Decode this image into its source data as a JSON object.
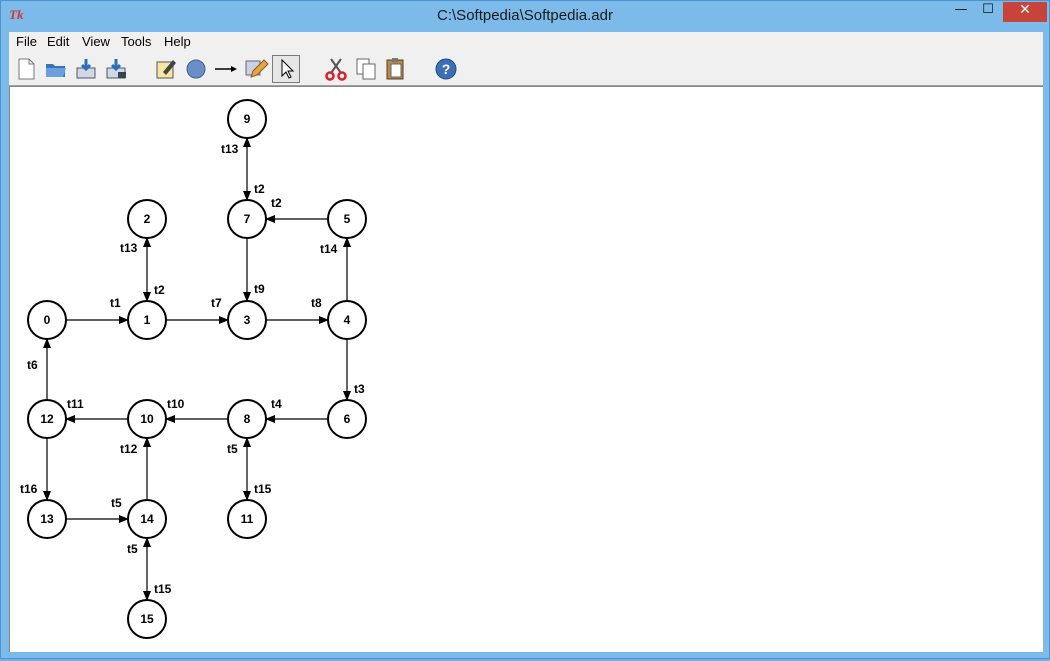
{
  "window": {
    "title": "C:\\Softpedia\\Softpedia.adr",
    "icon_text": "Tk",
    "minimize_glyph": "—",
    "maximize_glyph": "☐",
    "close_glyph": "✕"
  },
  "menu": [
    "File",
    "Edit",
    "View",
    "Tools",
    "Help"
  ],
  "toolbar": [
    "new-file-icon",
    "open-folder-icon",
    "save-icon",
    "save-as-icon",
    "edit-note-icon",
    "place-node-icon",
    "draw-arrow-icon",
    "edit-pencil-icon",
    "select-pointer-icon",
    "cut-scissors-icon",
    "copy-icon",
    "paste-clipboard-icon",
    "help-icon"
  ],
  "graph": {
    "nodes": [
      {
        "id": "0",
        "label": "0"
      },
      {
        "id": "1",
        "label": "1"
      },
      {
        "id": "2",
        "label": "2"
      },
      {
        "id": "3",
        "label": "3"
      },
      {
        "id": "4",
        "label": "4"
      },
      {
        "id": "5",
        "label": "5"
      },
      {
        "id": "6",
        "label": "6"
      },
      {
        "id": "7",
        "label": "7"
      },
      {
        "id": "8",
        "label": "8"
      },
      {
        "id": "9",
        "label": "9"
      },
      {
        "id": "10",
        "label": "10"
      },
      {
        "id": "11",
        "label": "11"
      },
      {
        "id": "12",
        "label": "12"
      },
      {
        "id": "13",
        "label": "13"
      },
      {
        "id": "14",
        "label": "14"
      },
      {
        "id": "15",
        "label": "15"
      }
    ],
    "edges": [
      {
        "from": "0",
        "to": "1",
        "labels": [
          "t1"
        ]
      },
      {
        "from": "1",
        "to": "2",
        "bidirectional": true,
        "labels": [
          "t13",
          "t2"
        ]
      },
      {
        "from": "1",
        "to": "3",
        "labels": [
          "t7"
        ]
      },
      {
        "from": "7",
        "to": "9",
        "bidirectional": true,
        "labels": [
          "t13",
          "t2"
        ]
      },
      {
        "from": "5",
        "to": "7",
        "labels": [
          "t2"
        ]
      },
      {
        "from": "7",
        "to": "3",
        "labels": [
          "t9"
        ]
      },
      {
        "from": "3",
        "to": "4",
        "labels": [
          "t8"
        ]
      },
      {
        "from": "4",
        "to": "5",
        "labels": [
          "t14"
        ]
      },
      {
        "from": "4",
        "to": "6",
        "labels": [
          "t3"
        ]
      },
      {
        "from": "6",
        "to": "8",
        "labels": [
          "t4"
        ]
      },
      {
        "from": "8",
        "to": "10",
        "labels": [
          "t10"
        ]
      },
      {
        "from": "10",
        "to": "12",
        "labels": [
          "t11"
        ]
      },
      {
        "from": "12",
        "to": "0",
        "labels": [
          "t6"
        ]
      },
      {
        "from": "12",
        "to": "13",
        "labels": [
          "t16"
        ]
      },
      {
        "from": "13",
        "to": "14",
        "labels": [
          "t5"
        ]
      },
      {
        "from": "14",
        "to": "10",
        "labels": [
          "t12"
        ]
      },
      {
        "from": "8",
        "to": "11",
        "bidirectional": true,
        "labels": [
          "t5",
          "t15"
        ]
      },
      {
        "from": "14",
        "to": "15",
        "bidirectional": true,
        "labels": [
          "t5",
          "t15"
        ]
      }
    ]
  }
}
